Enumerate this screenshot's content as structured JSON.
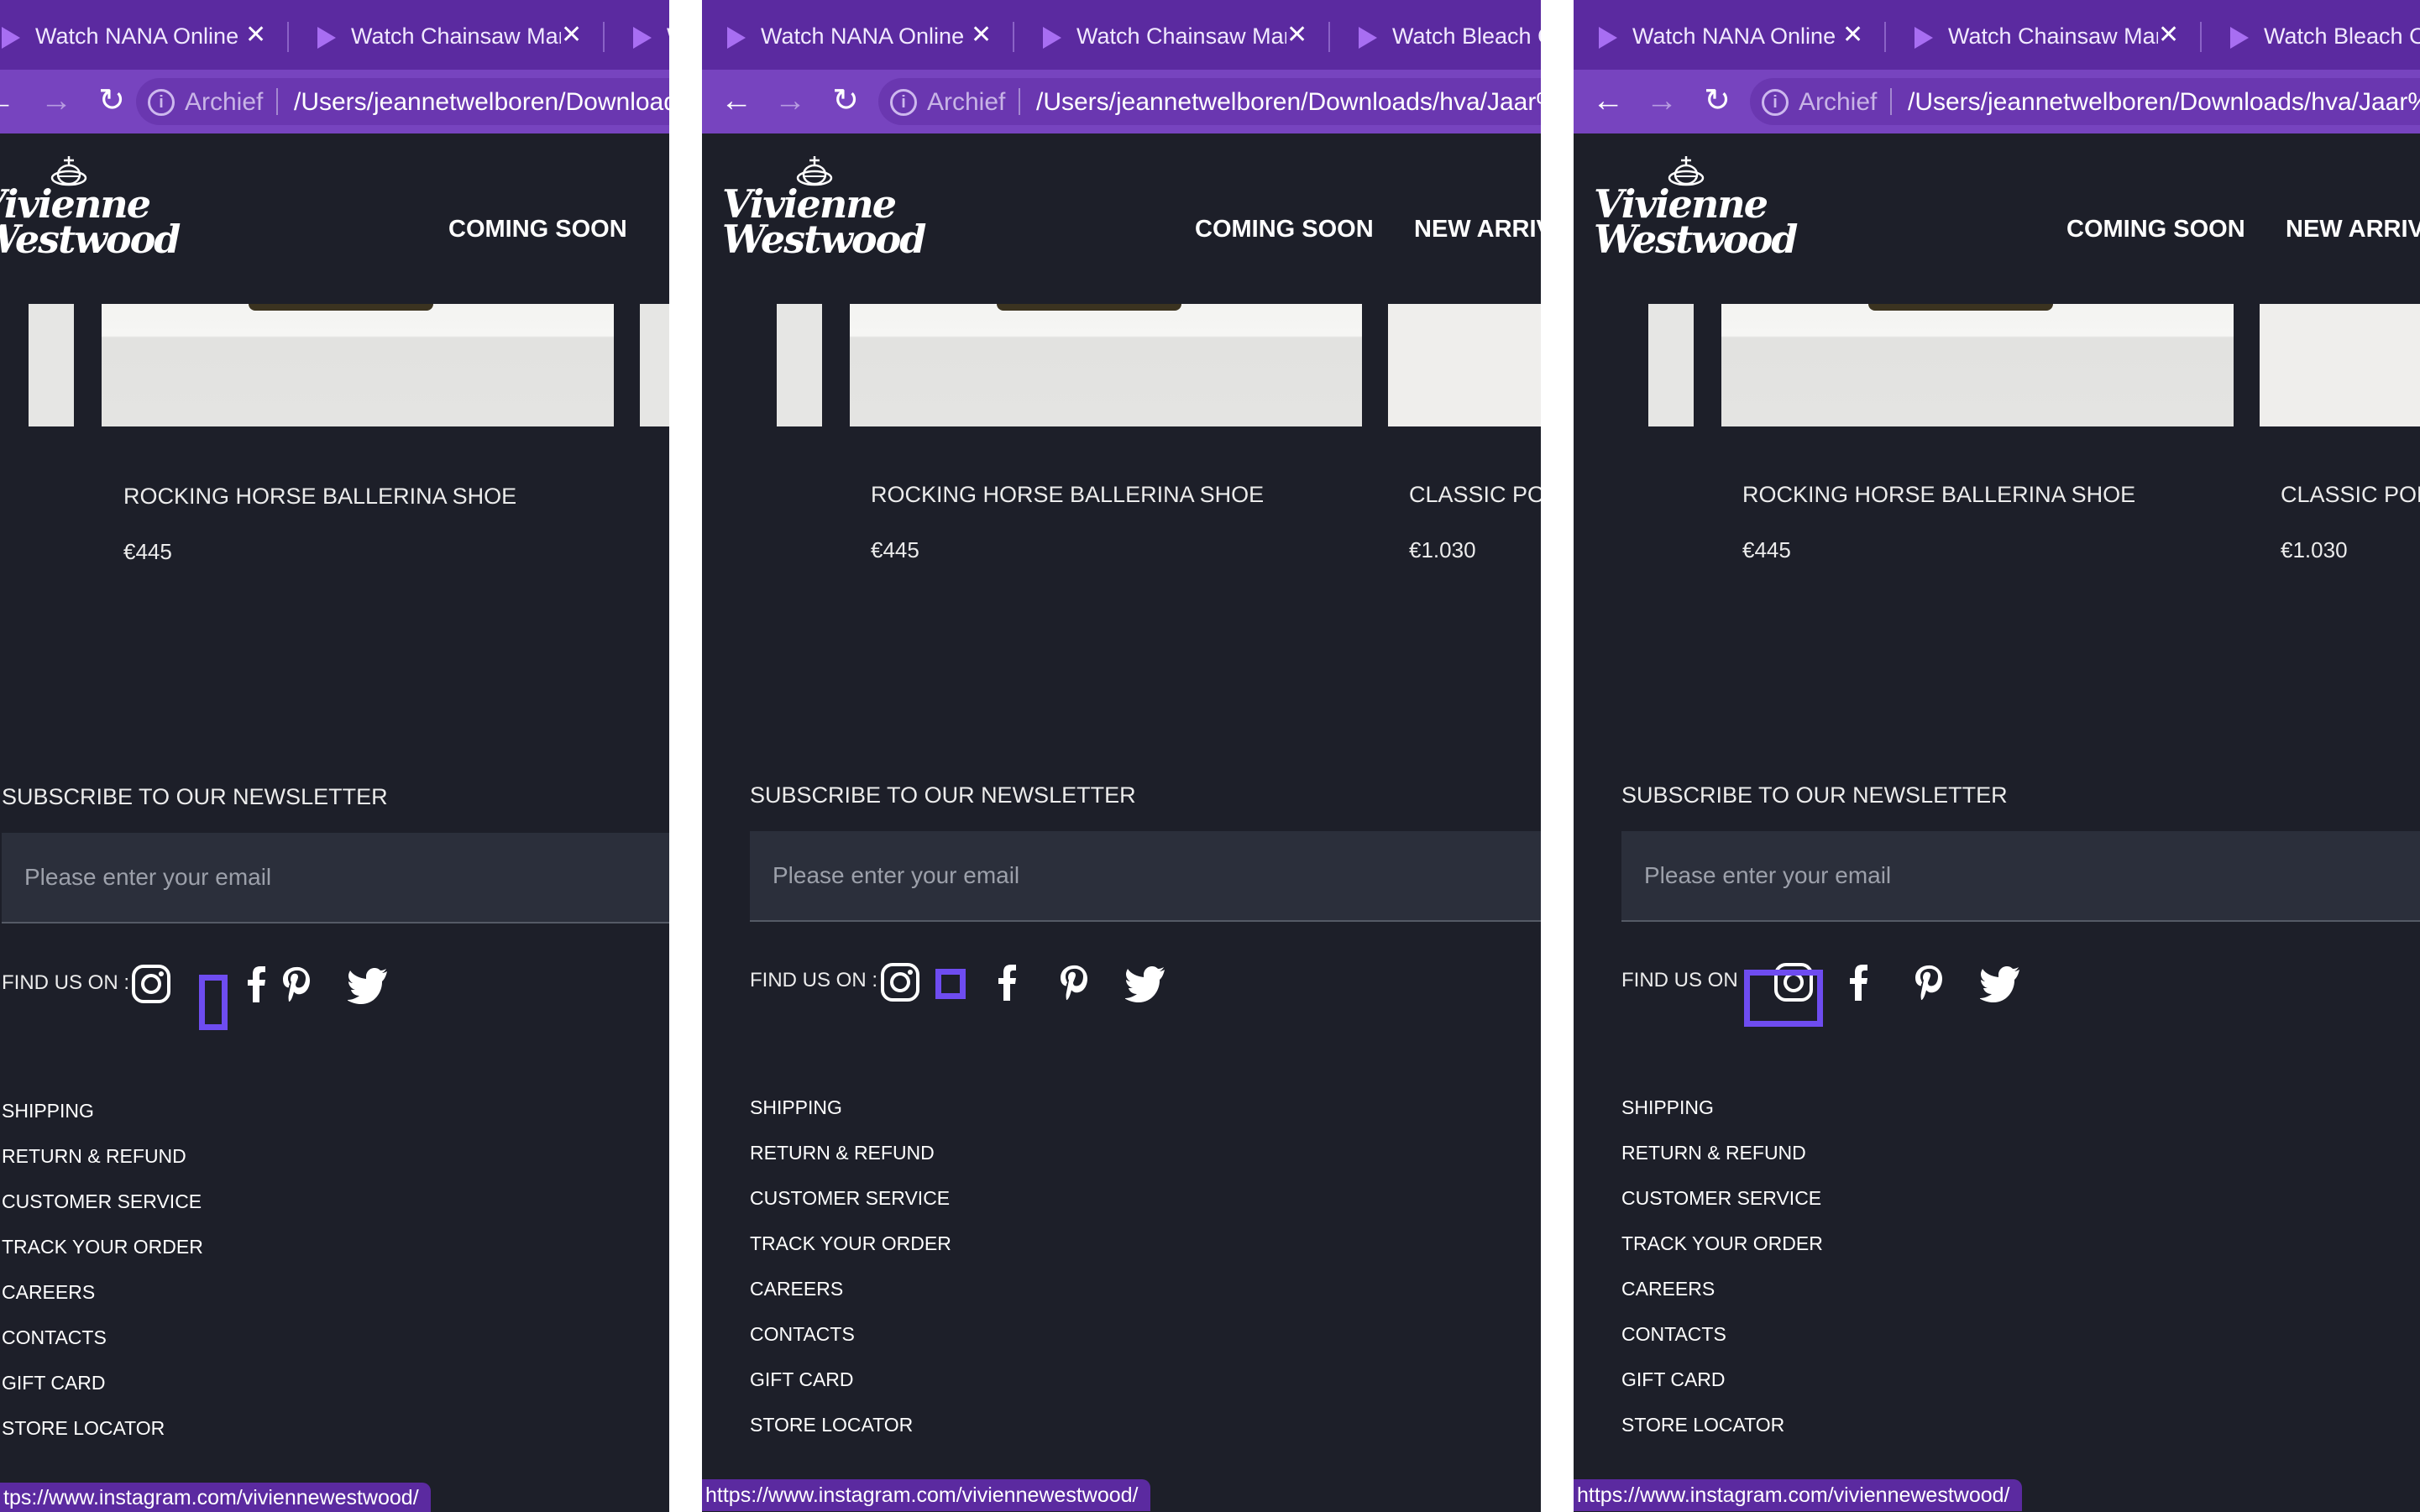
{
  "browser": {
    "tabs": [
      {
        "title": "Watch NANA Online in HD"
      },
      {
        "title": "Watch Chainsaw Man Online"
      },
      {
        "title": "Watch Bleach Online"
      }
    ],
    "address_scheme": "Archief",
    "urls": [
      "/Users/jeannetwelboren/Downloads/hva/Jaar%",
      "/Users/jeannetwelboren/Downloads/hva/Jaar%",
      "/Users/jeannetwelboren/Downloads/hva/Jaar%"
    ],
    "status_link": "https://www.instagram.com/viviennewestwood/",
    "status_link_truncated": "tps://www.instagram.com/viviennewestwood/",
    "back_icon": "arrow-left-icon",
    "forward_icon": "arrow-right-icon",
    "reload_icon": "reload-icon",
    "accent": "#5b2aa0"
  },
  "site": {
    "logo_line1": "Vivienne",
    "logo_line2": "Westwood",
    "menu": [
      "COMING SOON",
      "NEW ARRIVALS"
    ],
    "products": [
      {
        "name": "ROCKING HORSE BALLERINA SHOE",
        "price": "€445"
      },
      {
        "name": "CLASSIC PORTRAIT",
        "price": "€1.030"
      }
    ],
    "newsletter": {
      "title": "SUBSCRIBE TO OUR NEWSLETTER",
      "placeholder": "Please enter your email"
    },
    "find_us": "FIND US ON :",
    "social": [
      "instagram-icon",
      "facebook-icon",
      "pinterest-icon",
      "twitter-icon"
    ],
    "footer_links": [
      "SHIPPING",
      "RETURN & REFUND",
      "CUSTOMER SERVICE",
      "TRACK YOUR ORDER",
      "CAREERS",
      "CONTACTS",
      "GIFT CARD",
      "STORE LOCATOR"
    ],
    "background": "#1d1f29",
    "focus_color": "#6e4cf0"
  }
}
